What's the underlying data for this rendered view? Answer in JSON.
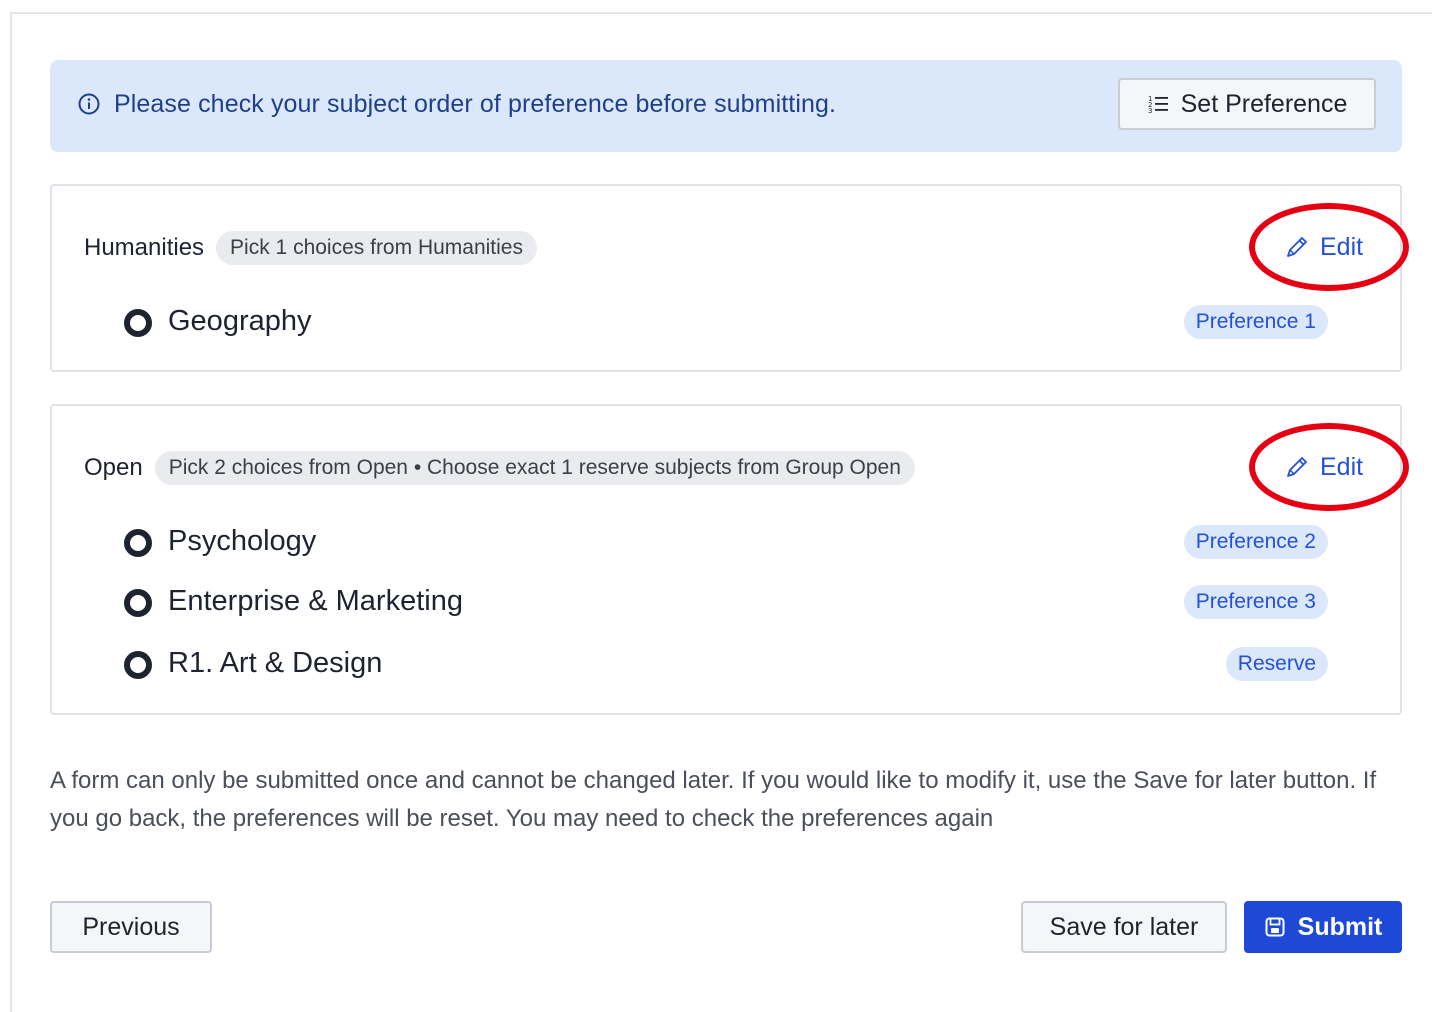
{
  "banner": {
    "message": "Please check your subject order of preference before submitting.",
    "set_preference_label": "Set Preference",
    "info_icon": "info-circle-icon",
    "list_icon": "ordered-list-icon"
  },
  "groups": [
    {
      "title": "Humanities",
      "rule": "Pick 1 choices from Humanities",
      "edit_label": "Edit",
      "highlighted": true,
      "subjects": [
        {
          "name": "Geography",
          "badge": "Preference 1"
        }
      ]
    },
    {
      "title": "Open",
      "rule": "Pick 2 choices from Open • Choose exact 1 reserve subjects from Group Open",
      "edit_label": "Edit",
      "highlighted": true,
      "subjects": [
        {
          "name": "Psychology",
          "badge": "Preference 2"
        },
        {
          "name": "Enterprise & Marketing",
          "badge": "Preference 3"
        },
        {
          "name": "R1. Art & Design",
          "badge": "Reserve"
        }
      ]
    }
  ],
  "footer": {
    "note": "A form can only be submitted once and cannot be changed later. If you would like to modify it, use the Save for later button. If you go back, the preferences will be reset. You may need to check the preferences again"
  },
  "actions": {
    "previous_label": "Previous",
    "save_label": "Save for later",
    "submit_label": "Submit"
  },
  "colors": {
    "accent": "#2451d6",
    "submit_bg": "#1d49d6",
    "banner_bg": "#dbe8fb",
    "highlight_ring": "#e60012"
  }
}
